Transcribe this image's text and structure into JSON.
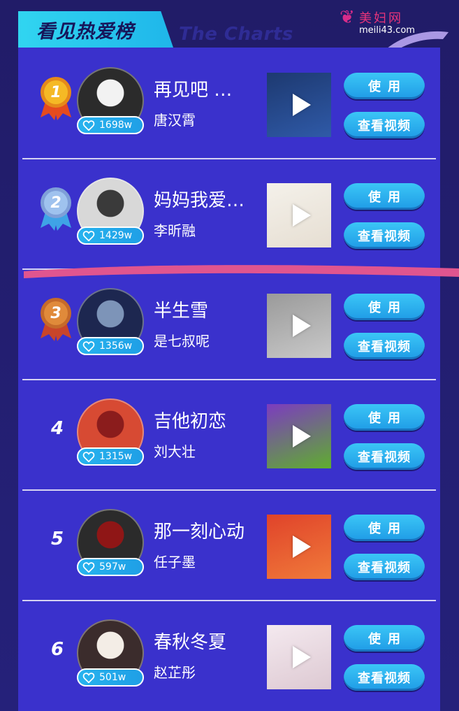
{
  "header": {
    "title": "看见热爱榜",
    "subtitle": "The Charts"
  },
  "watermark": {
    "brand": "美妇网",
    "url": "meili43.com"
  },
  "buttons": {
    "use_label": "使用",
    "video_label": "查看视频"
  },
  "songs": [
    {
      "rank": "1",
      "title": "再见吧 …",
      "artist": "唐汉霄",
      "likes": "1698w",
      "medal": "gold-medal-icon",
      "cover_colors": [
        "#1d3970",
        "#2f5aa8"
      ]
    },
    {
      "rank": "2",
      "title": "妈妈我爱…",
      "artist": "李昕融",
      "likes": "1429w",
      "medal": "silver-medal-icon",
      "cover_colors": [
        "#f4f1ea",
        "#e6ded2"
      ]
    },
    {
      "rank": "3",
      "title": "半生雪",
      "artist": "是七叔呢",
      "likes": "1356w",
      "medal": "bronze-medal-icon",
      "cover_colors": [
        "#9a9a9a",
        "#c9c9c9"
      ]
    },
    {
      "rank": "4",
      "title": "吉他初恋",
      "artist": "刘大壮",
      "likes": "1315w",
      "cover_colors": [
        "#7c3bc0",
        "#5fae2e"
      ]
    },
    {
      "rank": "5",
      "title": "那一刻心动",
      "artist": "任子墨",
      "likes": "597w",
      "cover_colors": [
        "#e0432a",
        "#f07a3a"
      ]
    },
    {
      "rank": "6",
      "title": "春秋冬夏",
      "artist": "赵芷彤",
      "likes": "501w",
      "cover_colors": [
        "#f4e9ef",
        "#ddc9d2"
      ]
    }
  ],
  "colors": {
    "background": "#211c68",
    "panel": "#3a31cc",
    "accent": "#1fb6ea",
    "annotation": "#e0558f"
  }
}
